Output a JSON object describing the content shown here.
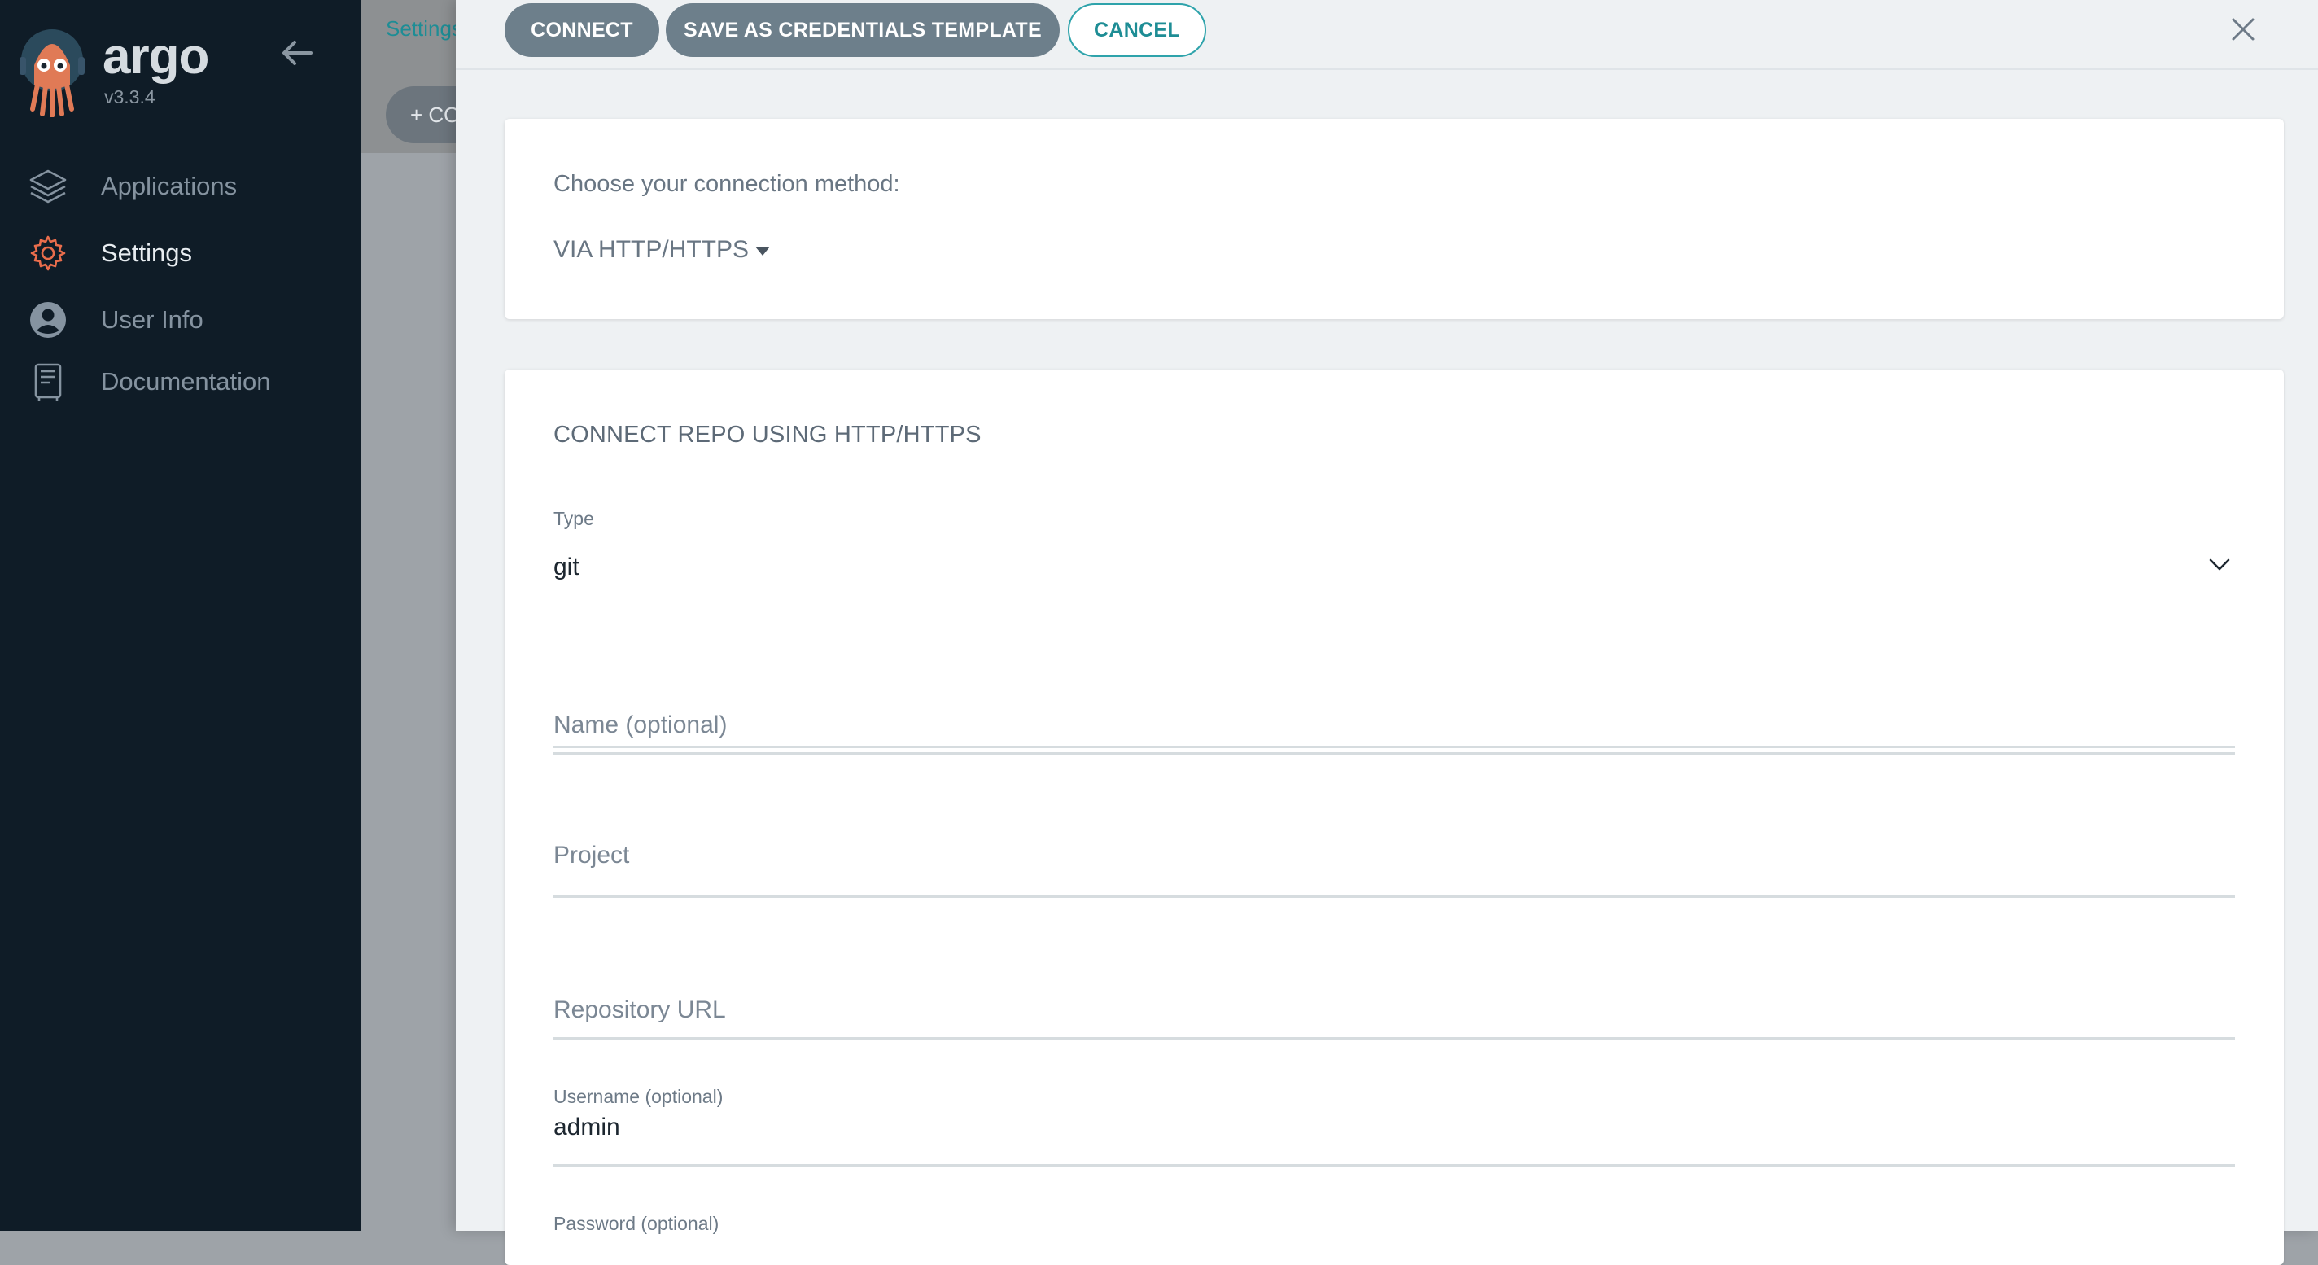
{
  "sidebar": {
    "brand": "argo",
    "version": "v3.3.4",
    "items": [
      {
        "label": "Applications",
        "icon": "layers-icon"
      },
      {
        "label": "Settings",
        "icon": "gear-icon"
      },
      {
        "label": "User Info",
        "icon": "user-icon"
      },
      {
        "label": "Documentation",
        "icon": "documentation-icon"
      }
    ]
  },
  "background": {
    "breadcrumb": "Settings",
    "button_label": "+ CO"
  },
  "panel": {
    "buttons": {
      "connect": "CONNECT",
      "save_template": "SAVE AS CREDENTIALS TEMPLATE",
      "cancel": "CANCEL"
    },
    "method": {
      "label": "Choose your connection method:",
      "selected": "VIA HTTP/HTTPS"
    },
    "form": {
      "title": "CONNECT REPO USING HTTP/HTTPS",
      "type_label": "Type",
      "type_value": "git",
      "name_placeholder": "Name (optional)",
      "project_placeholder": "Project",
      "repo_url_placeholder": "Repository URL",
      "username_label": "Username (optional)",
      "username_value": "admin",
      "password_label": "Password (optional)"
    }
  },
  "colors": {
    "sidebar_bg": "#0f1c27",
    "accent": "#1e8d95",
    "button_dark": "#6d7f8b",
    "settings_icon": "#e96d4c"
  }
}
